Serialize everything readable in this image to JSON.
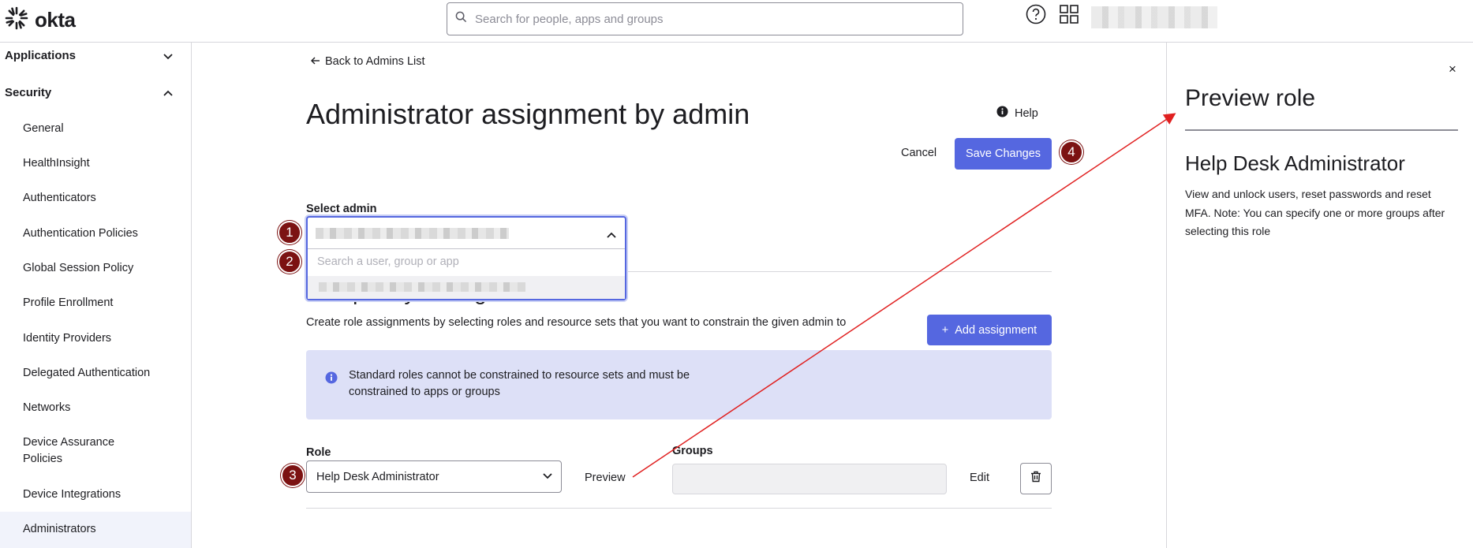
{
  "app": {
    "logo_text": "okta",
    "logo_icon": "okta-sunburst-icon"
  },
  "header": {
    "search_placeholder": "Search for people, apps and groups",
    "help_icon": "help-circle-icon",
    "apps_icon": "apps-grid-icon"
  },
  "sidebar": {
    "sections": [
      {
        "label": "Applications",
        "expanded": false
      },
      {
        "label": "Security",
        "expanded": true
      }
    ],
    "items": [
      {
        "label": "General"
      },
      {
        "label": "HealthInsight"
      },
      {
        "label": "Authenticators"
      },
      {
        "label": "Authentication Policies"
      },
      {
        "label": "Global Session Policy"
      },
      {
        "label": "Profile Enrollment"
      },
      {
        "label": "Identity Providers"
      },
      {
        "label": "Delegated Authentication"
      },
      {
        "label": "Networks"
      },
      {
        "label": "Device Assurance Policies"
      },
      {
        "label": "Device Integrations"
      },
      {
        "label": "Administrators"
      }
    ],
    "active_item": "Administrators"
  },
  "main": {
    "back_link": "Back to Admins List",
    "title": "Administrator assignment by admin",
    "help_label": "Help",
    "cancel_label": "Cancel",
    "save_label": "Save Changes",
    "select_admin_label": "Select admin",
    "search_placeholder": "Search a user, group or app",
    "section_heading": "Complexity settings",
    "description": "Create role assignments by selecting roles and resource sets that you want to constrain the given admin to",
    "add_assignment_label": "Add assignment",
    "callout_text": "Standard roles cannot be constrained to resource sets and must be constrained to apps or groups",
    "role_label": "Role",
    "role_value": "Help Desk Administrator",
    "preview_label": "Preview",
    "groups_label": "Groups",
    "groups_value": "",
    "edit_label": "Edit"
  },
  "annotations": {
    "steps": [
      "1",
      "2",
      "3",
      "4"
    ],
    "color": "#7c1212",
    "arrow_color": "#e02020"
  },
  "panel": {
    "title": "Preview role",
    "role_name": "Help Desk Administrator",
    "description": "View and unlock users, reset passwords and reset MFA. Note: You can specify one or more groups after selecting this role",
    "close_label": "×"
  },
  "colors": {
    "primary": "#5567e0",
    "callout_bg": "#dde0f7",
    "active_bg": "#f1f3fb"
  }
}
